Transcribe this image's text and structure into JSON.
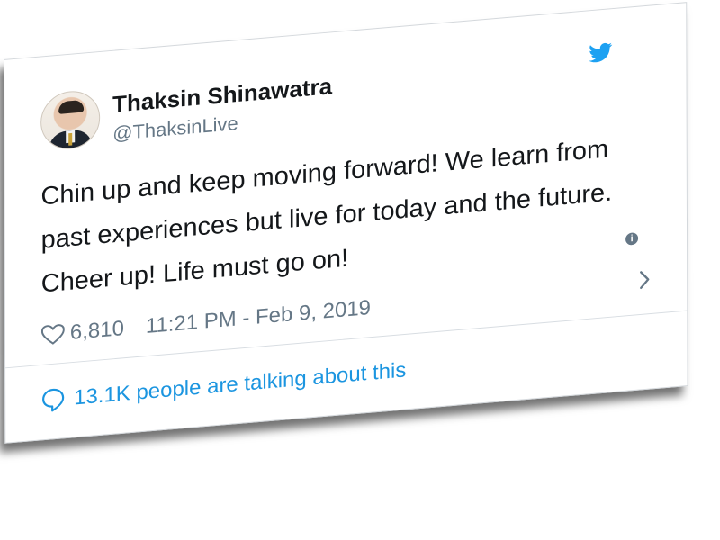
{
  "tweet": {
    "author_name": "Thaksin Shinawatra",
    "author_handle": "@ThaksinLive",
    "text": "Chin up and keep moving forward! We learn from past experiences but live for today and the future. Cheer up! Life must go on!",
    "likes": "6,810",
    "timestamp": "11:21 PM - Feb 9, 2019",
    "talking_about": "13.1K people are talking about this",
    "info_icon_glyph": "i"
  },
  "icons": {
    "brand": "twitter-bird-icon",
    "like": "heart-icon",
    "info": "info-icon",
    "more": "chevron-right-icon",
    "conversation": "speech-bubble-icon"
  },
  "colors": {
    "twitter_blue": "#1da1f2",
    "link_blue": "#1b95e0",
    "text_primary": "#14171a",
    "text_secondary": "#657786"
  }
}
